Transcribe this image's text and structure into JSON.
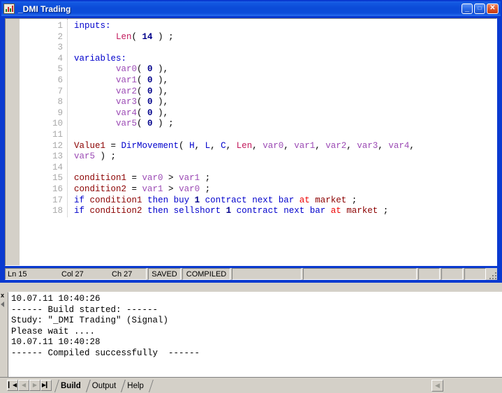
{
  "window": {
    "title": "_DMI Trading",
    "icon": "chart-icon",
    "buttons": {
      "minimize": "_",
      "maximize": "□",
      "close": "✕"
    }
  },
  "editor": {
    "lines": [
      {
        "no": "1",
        "tokens": [
          {
            "t": "inputs:",
            "c": "t-kw"
          }
        ]
      },
      {
        "no": "2",
        "tokens": [
          {
            "t": "        ",
            "c": "t-pl"
          },
          {
            "t": "Len",
            "c": "t-crim"
          },
          {
            "t": "( ",
            "c": "t-pl"
          },
          {
            "t": "14",
            "c": "t-num"
          },
          {
            "t": " ) ;",
            "c": "t-pl"
          }
        ]
      },
      {
        "no": "3",
        "tokens": []
      },
      {
        "no": "4",
        "tokens": [
          {
            "t": "variables:",
            "c": "t-kw"
          }
        ]
      },
      {
        "no": "5",
        "tokens": [
          {
            "t": "        ",
            "c": "t-pl"
          },
          {
            "t": "var0",
            "c": "t-var"
          },
          {
            "t": "( ",
            "c": "t-pl"
          },
          {
            "t": "0",
            "c": "t-num"
          },
          {
            "t": " ),",
            "c": "t-pl"
          }
        ]
      },
      {
        "no": "6",
        "tokens": [
          {
            "t": "        ",
            "c": "t-pl"
          },
          {
            "t": "var1",
            "c": "t-var"
          },
          {
            "t": "( ",
            "c": "t-pl"
          },
          {
            "t": "0",
            "c": "t-num"
          },
          {
            "t": " ),",
            "c": "t-pl"
          }
        ]
      },
      {
        "no": "7",
        "tokens": [
          {
            "t": "        ",
            "c": "t-pl"
          },
          {
            "t": "var2",
            "c": "t-var"
          },
          {
            "t": "( ",
            "c": "t-pl"
          },
          {
            "t": "0",
            "c": "t-num"
          },
          {
            "t": " ),",
            "c": "t-pl"
          }
        ]
      },
      {
        "no": "8",
        "tokens": [
          {
            "t": "        ",
            "c": "t-pl"
          },
          {
            "t": "var3",
            "c": "t-var"
          },
          {
            "t": "( ",
            "c": "t-pl"
          },
          {
            "t": "0",
            "c": "t-num"
          },
          {
            "t": " ),",
            "c": "t-pl"
          }
        ]
      },
      {
        "no": "9",
        "tokens": [
          {
            "t": "        ",
            "c": "t-pl"
          },
          {
            "t": "var4",
            "c": "t-var"
          },
          {
            "t": "( ",
            "c": "t-pl"
          },
          {
            "t": "0",
            "c": "t-num"
          },
          {
            "t": " ),",
            "c": "t-pl"
          }
        ]
      },
      {
        "no": "10",
        "tokens": [
          {
            "t": "        ",
            "c": "t-pl"
          },
          {
            "t": "var5",
            "c": "t-var"
          },
          {
            "t": "( ",
            "c": "t-pl"
          },
          {
            "t": "0",
            "c": "t-num"
          },
          {
            "t": " ) ;",
            "c": "t-pl"
          }
        ]
      },
      {
        "no": "11",
        "tokens": []
      },
      {
        "no": "12",
        "tokens": [
          {
            "t": "Value1",
            "c": "t-red"
          },
          {
            "t": " = ",
            "c": "t-pl"
          },
          {
            "t": "DirMovement",
            "c": "t-kw"
          },
          {
            "t": "( ",
            "c": "t-pl"
          },
          {
            "t": "H",
            "c": "t-kw"
          },
          {
            "t": ", ",
            "c": "t-pl"
          },
          {
            "t": "L",
            "c": "t-kw"
          },
          {
            "t": ", ",
            "c": "t-pl"
          },
          {
            "t": "C",
            "c": "t-kw"
          },
          {
            "t": ", ",
            "c": "t-pl"
          },
          {
            "t": "Len",
            "c": "t-crim"
          },
          {
            "t": ", ",
            "c": "t-pl"
          },
          {
            "t": "var0",
            "c": "t-var"
          },
          {
            "t": ", ",
            "c": "t-pl"
          },
          {
            "t": "var1",
            "c": "t-var"
          },
          {
            "t": ", ",
            "c": "t-pl"
          },
          {
            "t": "var2",
            "c": "t-var"
          },
          {
            "t": ", ",
            "c": "t-pl"
          },
          {
            "t": "var3",
            "c": "t-var"
          },
          {
            "t": ", ",
            "c": "t-pl"
          },
          {
            "t": "var4",
            "c": "t-var"
          },
          {
            "t": ",",
            "c": "t-pl"
          }
        ]
      },
      {
        "no": "13",
        "tokens": [
          {
            "t": "var5",
            "c": "t-var"
          },
          {
            "t": " ) ;",
            "c": "t-pl"
          }
        ]
      },
      {
        "no": "14",
        "tokens": []
      },
      {
        "no": "15",
        "tokens": [
          {
            "t": "condition1",
            "c": "t-red"
          },
          {
            "t": " = ",
            "c": "t-pl"
          },
          {
            "t": "var0",
            "c": "t-var"
          },
          {
            "t": " > ",
            "c": "t-pl"
          },
          {
            "t": "var1",
            "c": "t-var"
          },
          {
            "t": " ;",
            "c": "t-pl"
          }
        ]
      },
      {
        "no": "16",
        "tokens": [
          {
            "t": "condition2",
            "c": "t-red"
          },
          {
            "t": " = ",
            "c": "t-pl"
          },
          {
            "t": "var1",
            "c": "t-var"
          },
          {
            "t": " > ",
            "c": "t-pl"
          },
          {
            "t": "var0",
            "c": "t-var"
          },
          {
            "t": " ;",
            "c": "t-pl"
          }
        ]
      },
      {
        "no": "17",
        "tokens": [
          {
            "t": "if",
            "c": "t-kw"
          },
          {
            "t": " ",
            "c": "t-pl"
          },
          {
            "t": "condition1",
            "c": "t-red"
          },
          {
            "t": " ",
            "c": "t-pl"
          },
          {
            "t": "then",
            "c": "t-kw"
          },
          {
            "t": " ",
            "c": "t-pl"
          },
          {
            "t": "buy",
            "c": "t-kw"
          },
          {
            "t": " ",
            "c": "t-pl"
          },
          {
            "t": "1",
            "c": "t-num"
          },
          {
            "t": " ",
            "c": "t-pl"
          },
          {
            "t": "contract",
            "c": "t-kw"
          },
          {
            "t": " ",
            "c": "t-pl"
          },
          {
            "t": "next",
            "c": "t-kw"
          },
          {
            "t": " ",
            "c": "t-pl"
          },
          {
            "t": "bar",
            "c": "t-kw"
          },
          {
            "t": " ",
            "c": "t-pl"
          },
          {
            "t": "at",
            "c": "t-at"
          },
          {
            "t": " ",
            "c": "t-pl"
          },
          {
            "t": "market",
            "c": "t-red"
          },
          {
            "t": " ;",
            "c": "t-pl"
          }
        ]
      },
      {
        "no": "18",
        "tokens": [
          {
            "t": "if",
            "c": "t-kw"
          },
          {
            "t": " ",
            "c": "t-pl"
          },
          {
            "t": "condition2",
            "c": "t-red"
          },
          {
            "t": " ",
            "c": "t-pl"
          },
          {
            "t": "then",
            "c": "t-kw"
          },
          {
            "t": " ",
            "c": "t-pl"
          },
          {
            "t": "sellshort",
            "c": "t-kw"
          },
          {
            "t": " ",
            "c": "t-pl"
          },
          {
            "t": "1",
            "c": "t-num"
          },
          {
            "t": " ",
            "c": "t-pl"
          },
          {
            "t": "contract",
            "c": "t-kw"
          },
          {
            "t": " ",
            "c": "t-pl"
          },
          {
            "t": "next",
            "c": "t-kw"
          },
          {
            "t": " ",
            "c": "t-pl"
          },
          {
            "t": "bar",
            "c": "t-kw"
          },
          {
            "t": " ",
            "c": "t-pl"
          },
          {
            "t": "at",
            "c": "t-at"
          },
          {
            "t": " ",
            "c": "t-pl"
          },
          {
            "t": "market",
            "c": "t-red"
          },
          {
            "t": " ;",
            "c": "t-pl"
          }
        ]
      }
    ]
  },
  "statusbar": {
    "line": "Ln 15",
    "column": "Col 27",
    "character": "Ch 27",
    "saved": "SAVED",
    "compiled": "COMPILED"
  },
  "output": {
    "close_label": "x",
    "lines": [
      "10.07.11 10:40:26",
      "------ Build started: ------",
      "Study: \"_DMI Trading\" (Signal)",
      "Please wait ....",
      "10.07.11 10:40:28",
      "------ Compiled successfully  ------"
    ]
  },
  "tabbar": {
    "nav": [
      {
        "name": "first",
        "glyph": "▎◀",
        "dim": false
      },
      {
        "name": "previous",
        "glyph": "◀",
        "dim": true
      },
      {
        "name": "next",
        "glyph": "▶",
        "dim": true
      },
      {
        "name": "last",
        "glyph": "▶▎",
        "dim": false
      }
    ],
    "tabs": [
      {
        "label": "Build",
        "active": true
      },
      {
        "label": "Output",
        "active": false
      },
      {
        "label": "Help",
        "active": false
      }
    ],
    "scroll_left_glyph": "◀"
  },
  "colors": {
    "title_bar": "#0b4bd8",
    "window_frame": "#0a3ad0",
    "chrome": "#d4d0c8",
    "keyword": "#0000cc",
    "identifier_red": "#8b0000",
    "input_crimson": "#c2185b",
    "variable_purple": "#9c4bb5",
    "number": "#00008b",
    "at_keyword": "#ee0000"
  }
}
